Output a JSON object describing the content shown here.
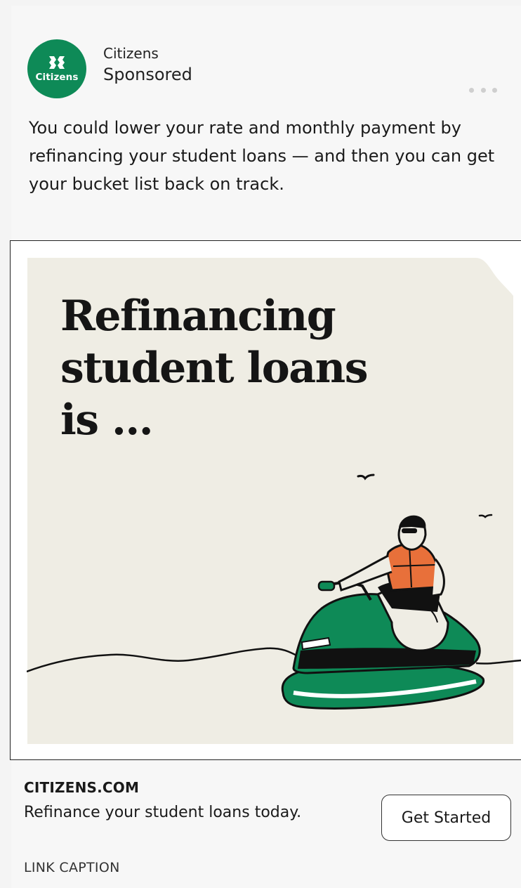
{
  "post": {
    "advertiser": "Citizens",
    "sponsored_label": "Sponsored",
    "avatar_text": "Citizens",
    "more_icon": "more-horizontal-icon",
    "body": "You could lower your rate and monthly payment by refinancing your student loans — and then you can get your bucket list back on track."
  },
  "creative": {
    "headline_line1": "Refinancing",
    "headline_line2": "student loans",
    "headline_line3": "is ...",
    "background_color": "#efede4",
    "brand_green": "#0e8a57",
    "vest_color": "#e8703a"
  },
  "footer": {
    "domain": "CITIZENS.COM",
    "description": "Refinance your student loans today.",
    "cta_label": "Get Started",
    "caption": "LINK CAPTION"
  }
}
